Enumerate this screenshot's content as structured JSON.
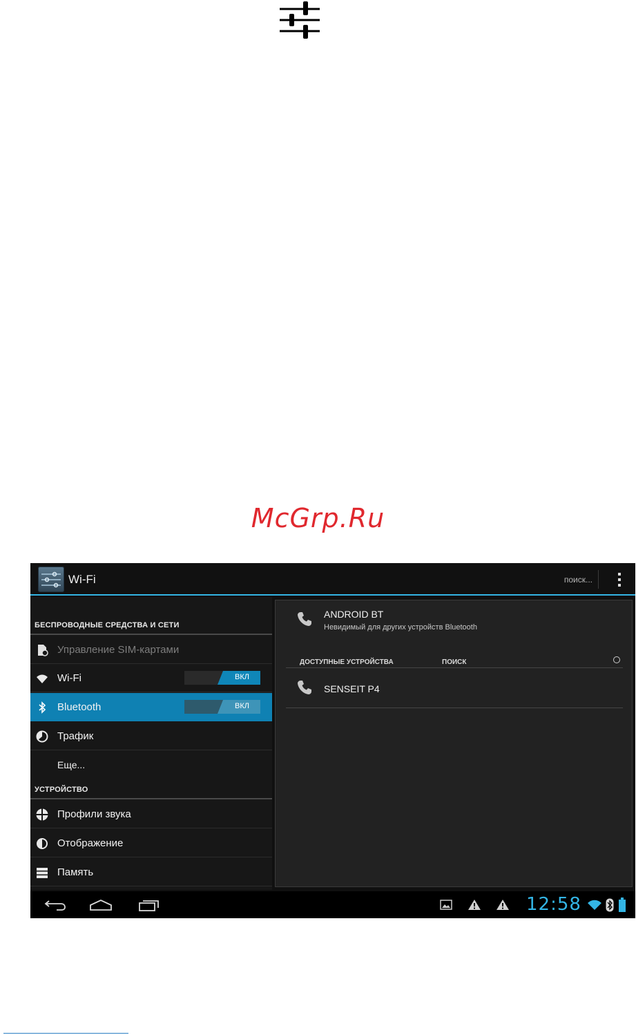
{
  "page": {
    "top_icon": "settings-sliders-icon",
    "watermark": "McGrp.Ru"
  },
  "screen": {
    "action_bar": {
      "title": "Wi-Fi",
      "search_label": "поиск...",
      "accent": "#33b5e5"
    },
    "left_panel": {
      "sections": [
        {
          "header": "БЕСПРОВОДНЫЕ СРЕДСТВА И СЕТИ",
          "items": [
            {
              "label": "Управление SIM-картами",
              "icon": "sim-card-icon",
              "disabled": true
            },
            {
              "label": "Wi-Fi",
              "icon": "wifi-icon",
              "toggle": "ВКЛ"
            },
            {
              "label": "Bluetooth",
              "icon": "bluetooth-icon",
              "toggle": "ВКЛ",
              "selected": true
            },
            {
              "label": "Трафик",
              "icon": "data-usage-icon"
            },
            {
              "label": "Еще..."
            }
          ]
        },
        {
          "header": "УСТРОЙСТВО",
          "items": [
            {
              "label": "Профили звука",
              "icon": "sound-icon"
            },
            {
              "label": "Отображение",
              "icon": "display-icon"
            },
            {
              "label": "Память",
              "icon": "storage-icon"
            }
          ]
        }
      ]
    },
    "right_panel": {
      "this_device": {
        "name": "ANDROID BT",
        "status": "Невидимый для других устройств Bluetooth"
      },
      "available_header": "ДОСТУПНЫЕ УСТРОЙСТВА",
      "search_label": "ПОИСК",
      "devices": [
        {
          "name": "SENSEIT P4",
          "icon": "phone-icon"
        }
      ]
    },
    "nav_bar": {
      "clock": "12:58",
      "status_icons": [
        "gallery-icon",
        "warning-icon",
        "warning-icon",
        "wifi-icon",
        "bluetooth-icon",
        "battery-icon"
      ],
      "nav_icons": [
        "back-icon",
        "home-icon",
        "recents-icon"
      ]
    }
  }
}
